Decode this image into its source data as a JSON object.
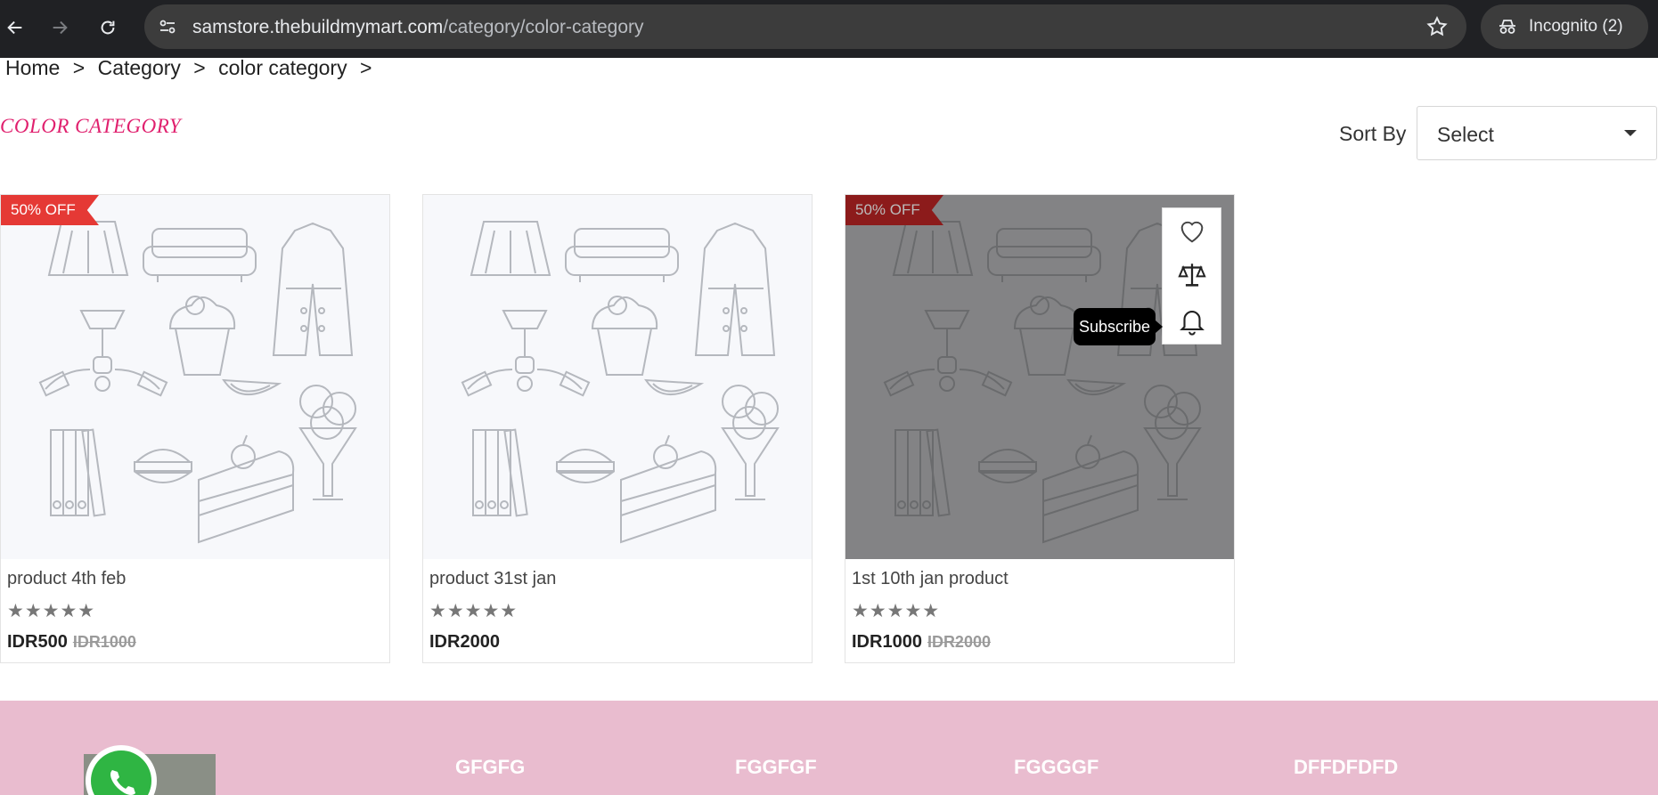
{
  "browser": {
    "url_domain": "samstore.thebuildmymart.com",
    "url_path": "/category/color-category",
    "incognito_label": "Incognito (2)"
  },
  "breadcrumb": {
    "items": [
      "Home",
      ">",
      "Category",
      ">",
      "color category",
      ">"
    ]
  },
  "page": {
    "title": "COLOR CATEGORY",
    "accent_color": "#e0206e"
  },
  "sort": {
    "label": "Sort By",
    "selected": "Select"
  },
  "products": [
    {
      "name": "product 4th feb",
      "badge": "50% OFF",
      "stars": "★★★★★",
      "price": "IDR500",
      "old_price": "IDR1000"
    },
    {
      "name": "product 31st jan",
      "badge": "",
      "stars": "★★★★★",
      "price": "IDR2000",
      "old_price": ""
    },
    {
      "name": "1st 10th jan product",
      "badge": "50% OFF",
      "stars": "★★★★★",
      "price": "IDR1000",
      "old_price": "IDR2000"
    }
  ],
  "hover_actions": {
    "tooltip": "Subscribe",
    "icons": [
      "heart-icon",
      "compare-scale-icon",
      "bell-icon"
    ]
  },
  "footer": {
    "background": "#e9bccf",
    "columns": [
      "GFGFG",
      "FGGFGF",
      "FGGGGF",
      "DFFDFDFD"
    ]
  }
}
